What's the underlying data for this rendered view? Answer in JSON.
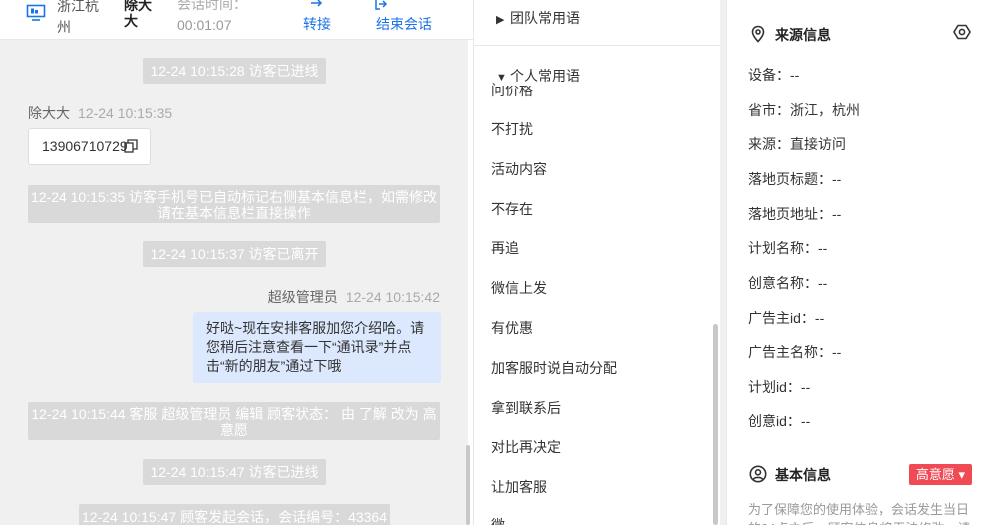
{
  "header": {
    "location": "浙江杭州",
    "visitor_name": "除大大",
    "duration_label": "会话时间：",
    "duration_value": "00:01:07",
    "transfer_label": "转接",
    "end_label": "结束会话"
  },
  "chat": {
    "messages": [
      {
        "type": "system",
        "text": "12-24 10:15:28 访客已进线"
      },
      {
        "type": "visitor",
        "sender": "除大大",
        "time": "12-24 10:15:35",
        "text": "13906710729"
      },
      {
        "type": "system",
        "text": "12-24 10:15:35 访客手机号已自动标记右侧基本信息栏，如需修改请在基本信息栏直接操作"
      },
      {
        "type": "system",
        "text": "12-24 10:15:37 访客已离开"
      },
      {
        "type": "agent",
        "sender": "超级管理员",
        "time": "12-24 10:15:42",
        "text": "好哒~现在安排客服加您介绍哈。请您稍后注意查看一下“通讯录”并点击“新的朋友”通过下哦"
      },
      {
        "type": "system",
        "text": "12-24 10:15:44 客服 超级管理员 编辑 顾客状态： 由 了解 改为 高意愿"
      },
      {
        "type": "system",
        "text": "12-24 10:15:47 访客已进线"
      },
      {
        "type": "system",
        "text": "12-24 10:15:47 顾客发起会话，会话编号：43364"
      }
    ]
  },
  "phrases": {
    "team_label": "团队常用语",
    "personal_label": "个人常用语",
    "items": [
      "问价格",
      "不打扰",
      "活动内容",
      "不存在",
      "再追",
      "微信上发",
      "有优惠",
      "加客服时说自动分配",
      "拿到联系后",
      "对比再决定",
      "让加客服",
      "微"
    ]
  },
  "source_info": {
    "title": "来源信息",
    "rows": [
      {
        "label": "设备：",
        "value": "--"
      },
      {
        "label": "省市：",
        "value": "浙江，杭州"
      },
      {
        "label": "来源：",
        "value": "直接访问"
      },
      {
        "label": "落地页标题：",
        "value": "--"
      },
      {
        "label": "落地页地址：",
        "value": "--"
      },
      {
        "label": "计划名称：",
        "value": "--"
      },
      {
        "label": "创意名称：",
        "value": "--"
      },
      {
        "label": "广告主id：",
        "value": "--"
      },
      {
        "label": "广告主名称：",
        "value": "--"
      },
      {
        "label": "计划id：",
        "value": "--"
      },
      {
        "label": "创意id：",
        "value": "--"
      }
    ]
  },
  "basic_info": {
    "title": "基本信息",
    "intent_badge": "高意愿 ▾",
    "notice": "为了保障您的使用体验，会话发生当日的24点之后，顾客信息将无法修改，请"
  },
  "colors": {
    "accent": "#1a73e8",
    "badge": "#f04a54",
    "agent_bubble": "#dbe8fd",
    "system_msg": "#d9d9d9"
  }
}
